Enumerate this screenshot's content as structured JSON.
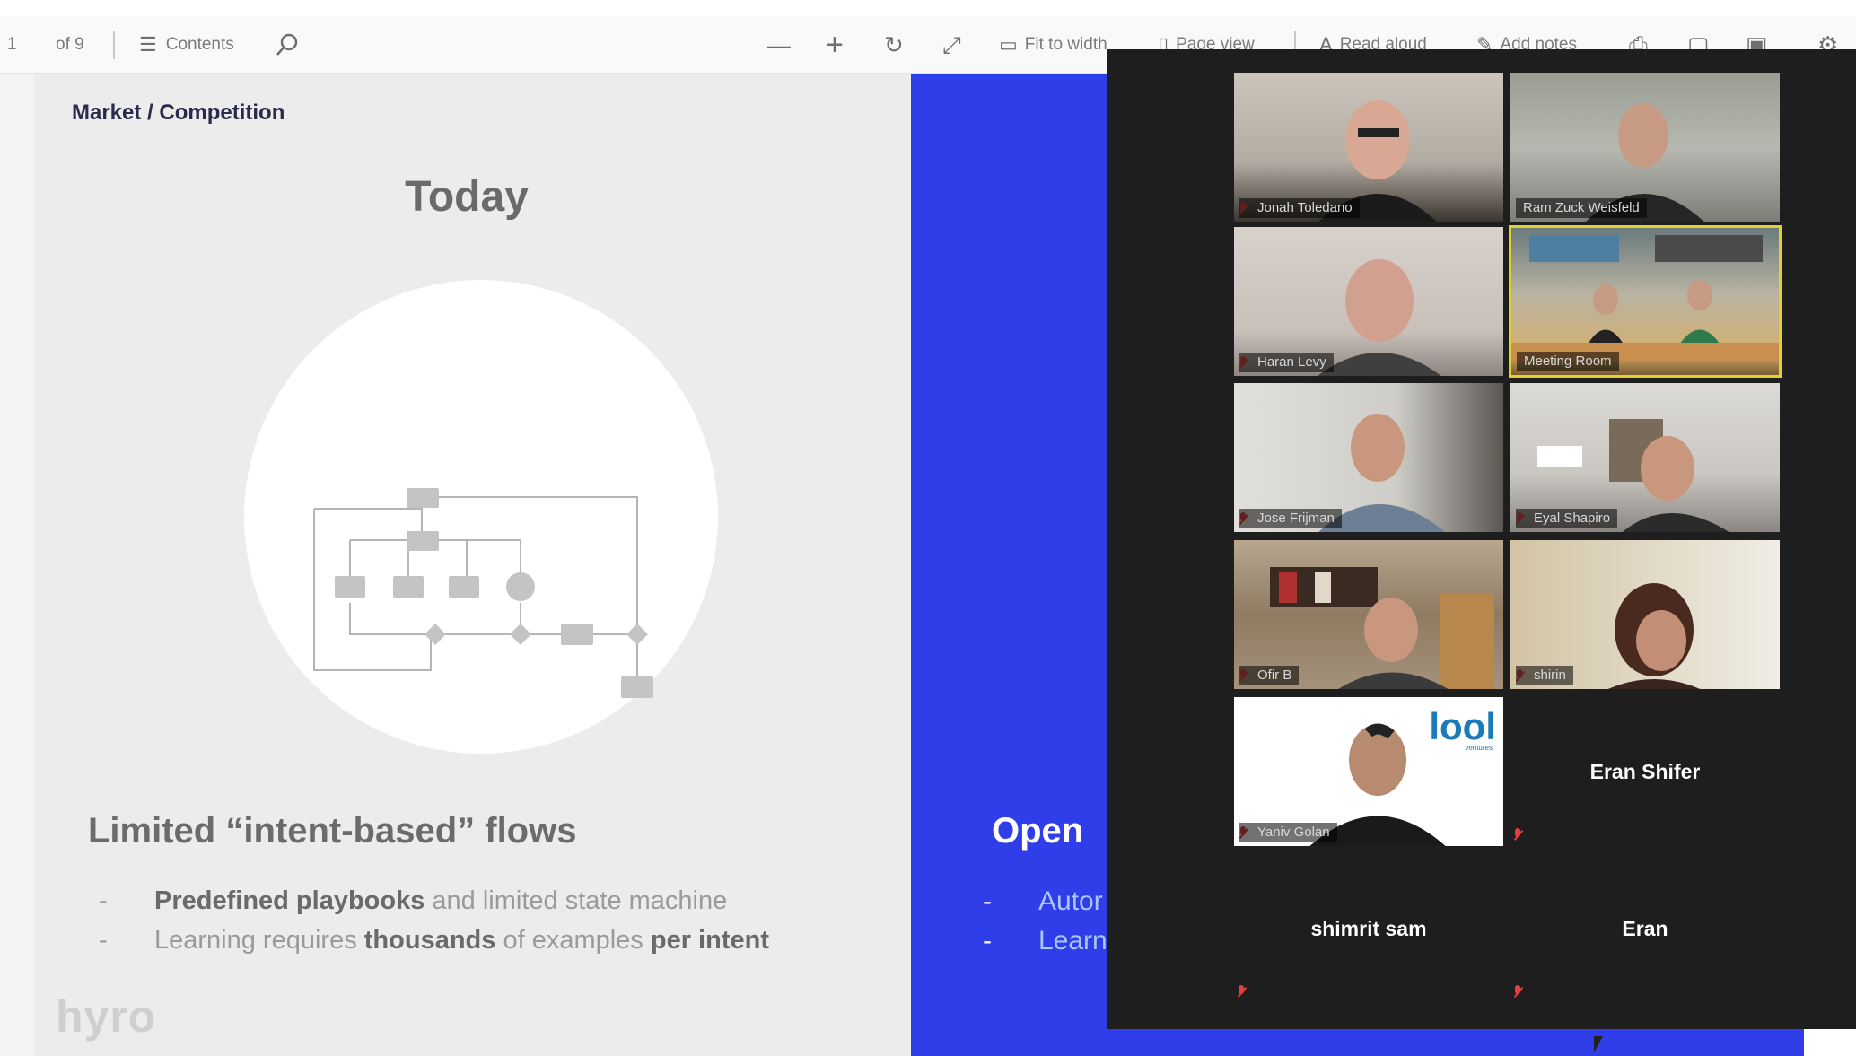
{
  "toolbar": {
    "page_current": "1",
    "page_total": "of 9",
    "contents_label": "Contents",
    "fit_to_width_label": "Fit to width",
    "page_view_label": "Page view",
    "read_aloud_label": "Read aloud",
    "add_notes_label": "Add notes"
  },
  "slide": {
    "breadcrumb": "Market / Competition",
    "title": "Today",
    "left_heading": "Limited “intent-based” flows",
    "left_bullets": [
      {
        "dash": "-",
        "p1": "Predefined playbooks",
        "p2": " and limited state machine",
        "p3": "",
        "p4": ""
      },
      {
        "dash": "-",
        "p1": "Learning requires ",
        "p2": "thousands",
        "p3": " of examples ",
        "p4": "per intent"
      }
    ],
    "logo_text": "hyro",
    "right_heading": "Open",
    "right_bullets": [
      "Autor",
      "Learn"
    ],
    "colors": {
      "right_panel": "#2f3ee8",
      "left_panel": "#ececed"
    }
  },
  "meeting": {
    "participants": [
      {
        "name": "Jonah Toledano",
        "muted": true
      },
      {
        "name": "Ram Zuck Weisfeld",
        "muted": false
      },
      {
        "name": "Haran Levy",
        "muted": true
      },
      {
        "name": "Meeting Room",
        "muted": false
      },
      {
        "name": "Jose Frijman",
        "muted": true
      },
      {
        "name": "Eyal Shapiro",
        "muted": true
      },
      {
        "name": "Ofir B",
        "muted": true
      },
      {
        "name": "shirin",
        "muted": true
      },
      {
        "name": "Yaniv Golan",
        "muted": true
      },
      {
        "name": "Eran Shifer",
        "muted": true
      },
      {
        "name": "shimrit sam",
        "muted": true
      },
      {
        "name": "Eran",
        "muted": true
      }
    ],
    "tile_logo": "lool",
    "tile_logo_sub": "ventures"
  }
}
